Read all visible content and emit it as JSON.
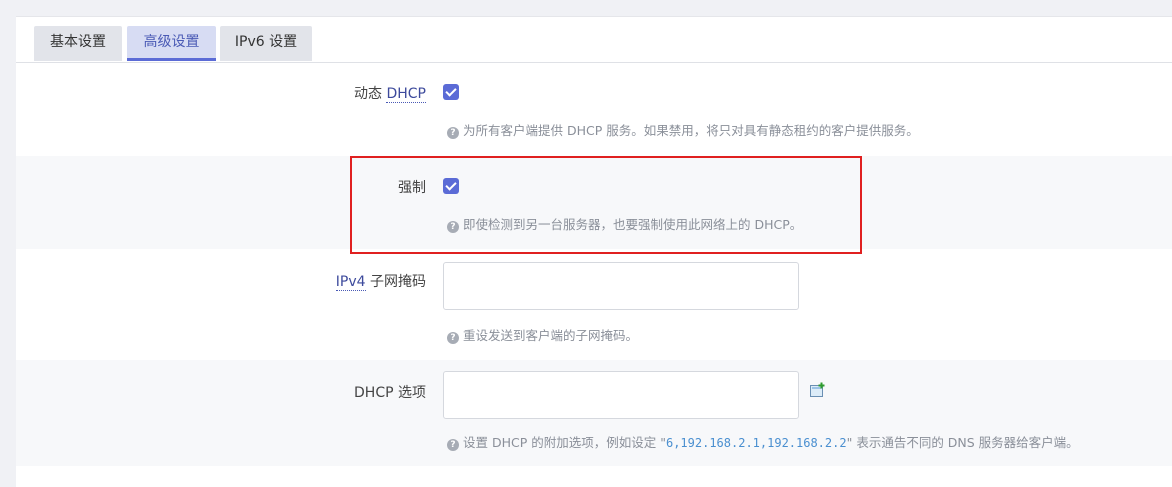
{
  "tabs": [
    {
      "label": "基本设置",
      "active": false
    },
    {
      "label": "高级设置",
      "active": true
    },
    {
      "label": "IPv6 设置",
      "active": false
    }
  ],
  "fields": {
    "dynamic_dhcp": {
      "label_prefix": "动态",
      "label_abbr": "DHCP",
      "checked": true,
      "hint": "为所有客户端提供 DHCP 服务。如果禁用，将只对具有静态租约的客户提供服务。"
    },
    "force": {
      "label": "强制",
      "checked": true,
      "hint": "即使检测到另一台服务器，也要强制使用此网络上的 DHCP。"
    },
    "ipv4_netmask": {
      "label_abbr": "IPv4",
      "label_suffix": "子网掩码",
      "value": "",
      "hint": "重设发送到客户端的子网掩码。"
    },
    "dhcp_options": {
      "label": "DHCP 选项",
      "value": "",
      "hint_before": "设置 DHCP 的附加选项，例如设定 \"",
      "hint_code": "6,192.168.2.1,192.168.2.2",
      "hint_after": "\" 表示通告不同的 DNS 服务器给客户端。"
    }
  },
  "icons": {
    "help": "help-circle-icon",
    "add": "add-item-icon"
  },
  "colors": {
    "accent": "#5b6bd6",
    "highlight_border": "#e02020",
    "hint_text": "#8a8f99"
  }
}
